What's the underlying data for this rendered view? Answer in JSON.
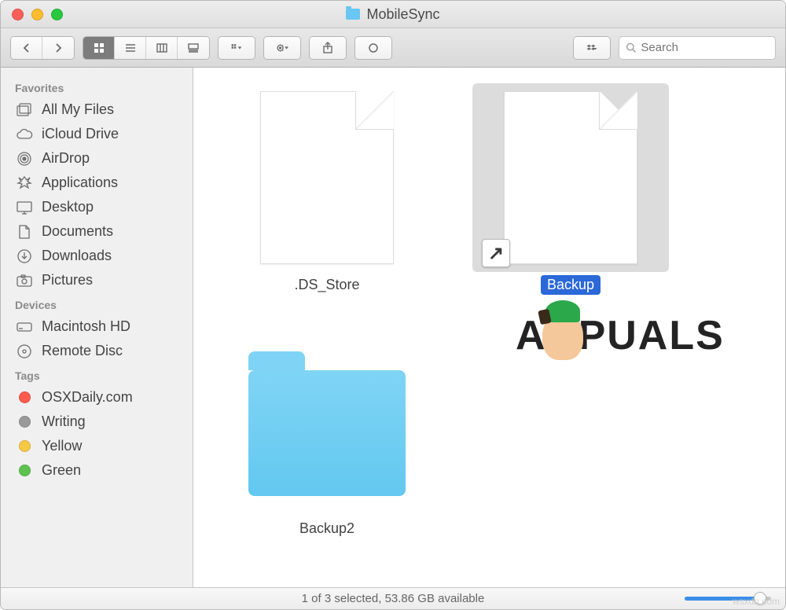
{
  "window": {
    "title": "MobileSync"
  },
  "toolbar": {
    "search_placeholder": "Search"
  },
  "sidebar": {
    "sections": [
      {
        "title": "Favorites",
        "items": [
          {
            "label": "All My Files",
            "icon": "all-files"
          },
          {
            "label": "iCloud Drive",
            "icon": "cloud"
          },
          {
            "label": "AirDrop",
            "icon": "airdrop"
          },
          {
            "label": "Applications",
            "icon": "apps"
          },
          {
            "label": "Desktop",
            "icon": "desktop"
          },
          {
            "label": "Documents",
            "icon": "documents"
          },
          {
            "label": "Downloads",
            "icon": "downloads"
          },
          {
            "label": "Pictures",
            "icon": "pictures"
          }
        ]
      },
      {
        "title": "Devices",
        "items": [
          {
            "label": "Macintosh HD",
            "icon": "hd"
          },
          {
            "label": "Remote Disc",
            "icon": "disc"
          }
        ]
      },
      {
        "title": "Tags",
        "items": [
          {
            "label": "OSXDaily.com",
            "color": "#ff5b4f"
          },
          {
            "label": "Writing",
            "color": "#9a9a9a"
          },
          {
            "label": "Yellow",
            "color": "#f6c945"
          },
          {
            "label": "Green",
            "color": "#5ec24e"
          }
        ]
      }
    ]
  },
  "files": [
    {
      "name": ".DS_Store",
      "type": "document",
      "selected": false
    },
    {
      "name": "Backup",
      "type": "alias",
      "selected": true
    },
    {
      "name": "Backup2",
      "type": "folder",
      "selected": false
    }
  ],
  "status": {
    "text": "1 of 3 selected, 53.86 GB available"
  },
  "watermark": {
    "prefix": "A",
    "suffix": "PUALS"
  },
  "corner_url": "wsxdn.com"
}
